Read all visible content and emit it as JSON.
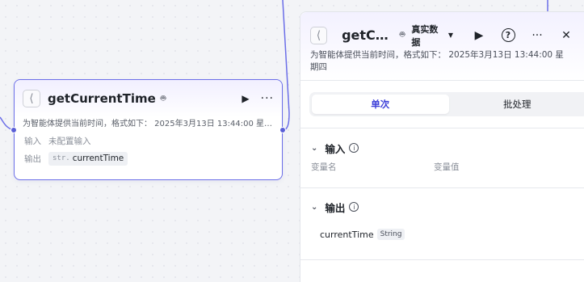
{
  "node": {
    "title": "getCurrentTime",
    "description": "为智能体提供当前时间，格式如下： 2025年3月13日 13:44:00 星期四",
    "input_label": "输入",
    "input_value": "未配置输入",
    "output_label": "输出",
    "output_type": "str.",
    "output_name": "currentTime"
  },
  "panel": {
    "title": "getC…",
    "data_source": "真实数据",
    "description": "为智能体提供当前时间，格式如下： 2025年3月13日 13:44:00 星期四",
    "tabs": [
      "单次",
      "批处理"
    ],
    "active_tab": "单次",
    "input_section": {
      "title": "输入",
      "columns": [
        "变量名",
        "变量值"
      ]
    },
    "output_section": {
      "title": "输出",
      "variable": "currentTime",
      "type": "String"
    }
  },
  "icons": {
    "tool": "tool-icon",
    "robot": "robot-icon",
    "play": "play-icon",
    "more": "more-icon",
    "help": "help-icon",
    "close": "close-icon",
    "chevron": "chevron-down-icon",
    "info": "info-icon"
  },
  "colors": {
    "accent": "#6b6ee8",
    "active_tab_text": "#3c3fd8",
    "edge": "#5a5fd6"
  }
}
